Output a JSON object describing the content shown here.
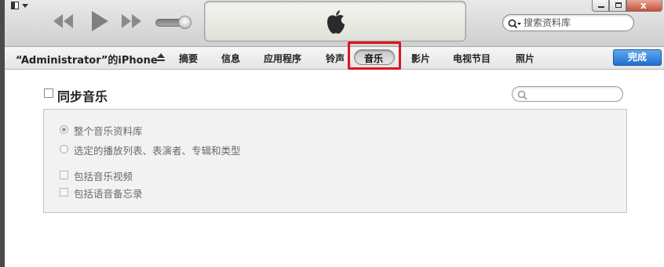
{
  "toolbar": {
    "search_placeholder": "搜索资料库",
    "icons": [
      "menu-toggle-icon",
      "rewind-icon",
      "play-icon",
      "fast-forward-icon",
      "volume-slider",
      "apple-logo-icon",
      "minimize-icon",
      "maximize-icon",
      "close-icon",
      "search-icon"
    ],
    "window_close_glyph": "x"
  },
  "navbar": {
    "device_name": "“Administrator”的iPhone",
    "tabs": [
      "摘要",
      "信息",
      "应用程序",
      "铃声",
      "音乐",
      "影片",
      "电视节目",
      "照片"
    ],
    "active_tab": "音乐",
    "done_label": "完成",
    "highlight_color": "#e0141d",
    "done_color": "#1f6fcf"
  },
  "content": {
    "sync_title": "同步音乐",
    "sync_checked": false,
    "options": {
      "entire_library": "整个音乐资料库",
      "selected": "选定的播放列表、表演者、专辑和类型",
      "include_videos": "包括音乐视频",
      "include_voice_memos": "包括语音备忘录"
    },
    "selected_option": "entire_library"
  }
}
